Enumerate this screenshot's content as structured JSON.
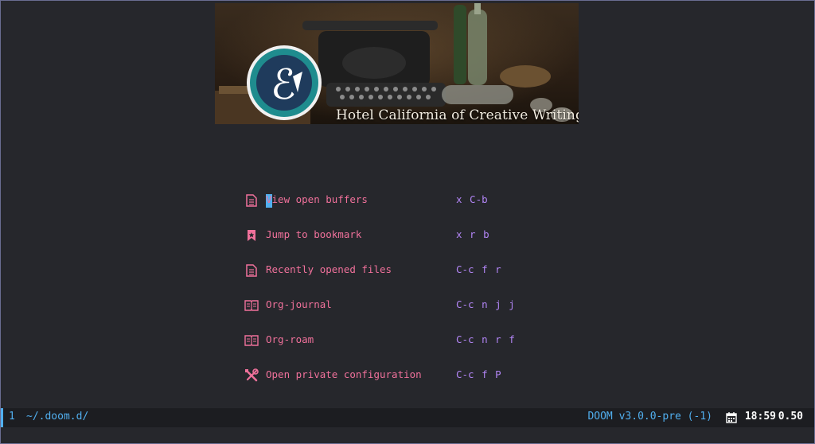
{
  "banner": {
    "caption": "Hotel California of Creative Writing",
    "logo_icon": "quill-e-logo-icon"
  },
  "menu": [
    {
      "icon": "document-icon",
      "label": "View open buffers",
      "key": "x C-b"
    },
    {
      "icon": "bookmark-icon",
      "label": "Jump to bookmark",
      "key": "x r b"
    },
    {
      "icon": "document-icon",
      "label": "Recently opened files",
      "key": "C-c f r"
    },
    {
      "icon": "book-icon",
      "label": "Org-journal",
      "key": "C-c n j j"
    },
    {
      "icon": "book-icon",
      "label": "Org-roam",
      "key": "C-c n r f"
    },
    {
      "icon": "tools-icon",
      "label": "Open private configuration",
      "key": "C-c f P"
    }
  ],
  "modeline": {
    "window_number": "1",
    "path": "~/.doom.d/",
    "doom_version": "DOOM v3.0.0-pre (-1)",
    "time": "18:59",
    "load": "0.50"
  },
  "colors": {
    "background": "#26272c",
    "label": "#f0719b",
    "keybinding": "#b285f5",
    "accent": "#51afef"
  }
}
